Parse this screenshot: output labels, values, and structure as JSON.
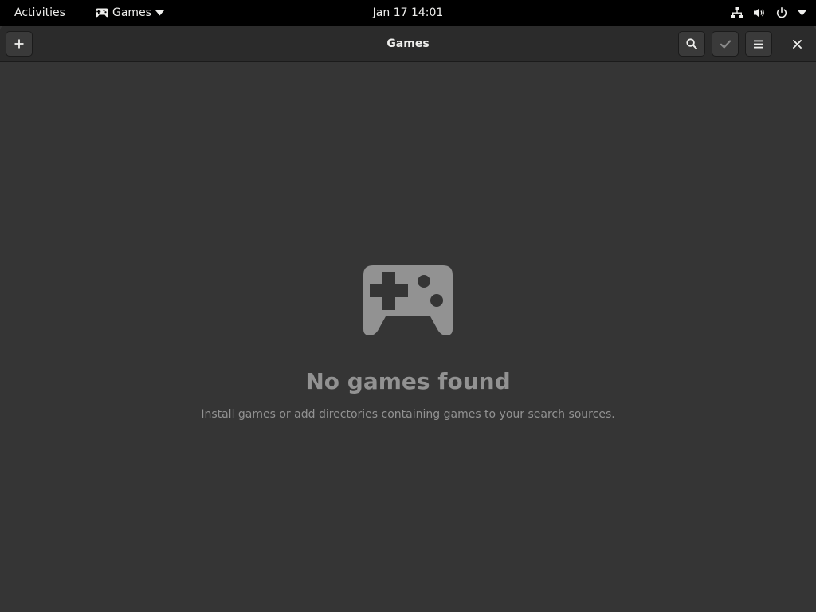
{
  "topbar": {
    "activities_label": "Activities",
    "app_name": "Games",
    "clock": "Jan 17  14:01"
  },
  "window": {
    "title": "Games"
  },
  "empty_state": {
    "title": "No games found",
    "description": "Install games or add directories containing games to your search sources."
  },
  "icons": {
    "topbar_app": "gamepad-icon",
    "app_menu_arrow": "chevron-down-icon",
    "network": "network-wired-icon",
    "volume": "volume-icon",
    "power": "power-icon",
    "system_menu_arrow": "chevron-down-icon",
    "add": "plus-icon",
    "search": "search-icon",
    "select": "checkmark-icon",
    "menu": "hamburger-menu-icon",
    "close": "close-icon",
    "empty": "gamepad-icon"
  },
  "colors": {
    "topbar_bg": "#000000",
    "headerbar_bg": "#2b2b2b",
    "window_bg": "#353535",
    "text_primary": "#eeeeec",
    "text_dim": "#929292"
  }
}
